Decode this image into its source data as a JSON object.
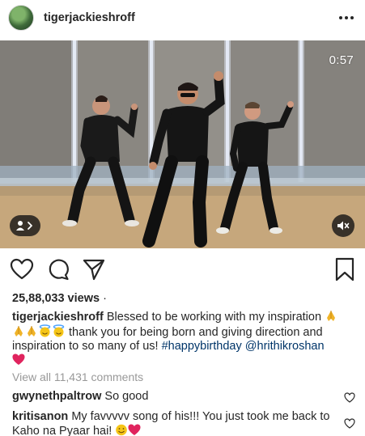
{
  "post": {
    "username": "tigerjackieshroff",
    "video_time": "0:57",
    "views_count": "25,88,033 views",
    "views_sep": " ·",
    "caption_user": "tigerjackieshroff",
    "caption_line1": "Blessed to be working with my inspiration",
    "caption_line2": "thank you for being born and giving direction and inspiration to so many of us!",
    "hashtag": "#happybirthday",
    "mention": "@hrithikroshan",
    "view_all_comments": "View all 11,431 comments"
  },
  "comments": [
    {
      "user": "gwynethpaltrow",
      "text": "So good"
    },
    {
      "user": "kritisanon",
      "text": "My favvvvv song of his!!! You just took me back to Kaho na Pyaar hai!"
    }
  ],
  "icons": {
    "like": "heart-icon",
    "comment": "comment-icon",
    "share": "paper-plane-icon",
    "save": "bookmark-icon",
    "tag": "user-tag-icon",
    "mute": "speaker-muted-icon"
  },
  "colors": {
    "text": "#262626",
    "link": "#003569",
    "muted": "#999999",
    "heart_red": "#ed4956"
  }
}
